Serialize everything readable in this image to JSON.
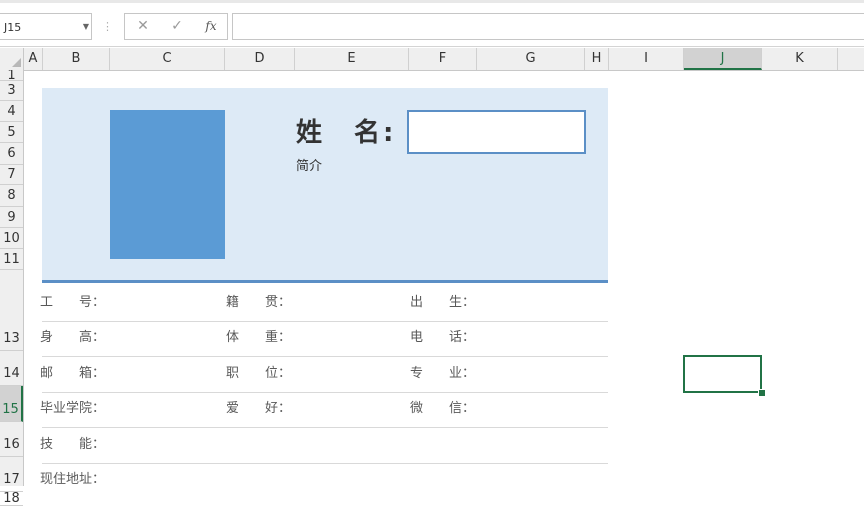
{
  "formula_bar": {
    "name_box": "J15",
    "cancel_icon": "✕",
    "enter_icon": "✓",
    "function_icon": "fx",
    "formula": ""
  },
  "columns": [
    {
      "label": "A",
      "selected": false
    },
    {
      "label": "B",
      "selected": false
    },
    {
      "label": "C",
      "selected": false
    },
    {
      "label": "D",
      "selected": false
    },
    {
      "label": "E",
      "selected": false
    },
    {
      "label": "F",
      "selected": false
    },
    {
      "label": "G",
      "selected": false
    },
    {
      "label": "H",
      "selected": false
    },
    {
      "label": "I",
      "selected": false
    },
    {
      "label": "J",
      "selected": true
    },
    {
      "label": "K",
      "selected": false
    }
  ],
  "rows": [
    "1",
    "3",
    "4",
    "5",
    "6",
    "7",
    "8",
    "9",
    "10",
    "11",
    "13",
    "14",
    "15",
    "16",
    "17",
    "18"
  ],
  "selected_row": "15",
  "resume": {
    "name_label": "姓　名:",
    "name_value": "",
    "intro_label": "简介",
    "fields": [
      [
        "工　　号：",
        "籍　　贯：",
        "出　　生："
      ],
      [
        "身　　高：",
        "体　　重：",
        "电　　话："
      ],
      [
        "邮　　箱：",
        "职　　位：",
        "专　　业："
      ],
      [
        "毕业学院：",
        "爱　　好：",
        "微　　信："
      ],
      [
        "技　　能："
      ],
      [
        "现住地址："
      ]
    ]
  },
  "colors": {
    "banner": "#ddeaf6",
    "accent": "#5b8fc6",
    "photo": "#5b9bd5",
    "selection": "#217346"
  }
}
